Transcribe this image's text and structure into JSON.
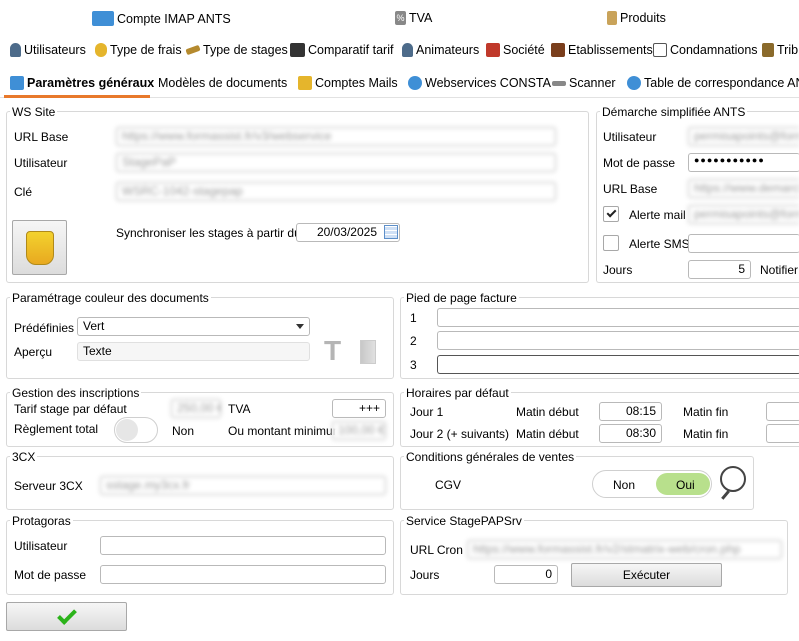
{
  "tabs_row1": [
    {
      "label": "Compte IMAP ANTS",
      "icon": "envelope-icon"
    },
    {
      "label": "TVA",
      "icon": "percent-icon"
    },
    {
      "label": "Produits",
      "icon": "bag-icon"
    }
  ],
  "tabs_row2": [
    {
      "label": "Utilisateurs",
      "icon": "user-icon"
    },
    {
      "label": "Type de frais",
      "icon": "euro-icon"
    },
    {
      "label": "Type de stages",
      "icon": "pencil-icon"
    },
    {
      "label": "Comparatif tarif",
      "icon": "people-icon"
    },
    {
      "label": "Animateurs",
      "icon": "person-icon"
    },
    {
      "label": "Société",
      "icon": "house-icon"
    },
    {
      "label": "Etablissements",
      "icon": "building-icon"
    },
    {
      "label": "Condamnations",
      "icon": "scales-icon"
    },
    {
      "label": "Trib",
      "icon": "court-icon"
    }
  ],
  "tabs_row3": [
    {
      "label": "Paramètres généraux",
      "icon": "settings-icon",
      "active": true
    },
    {
      "label": "Modèles de documents",
      "icon": ""
    },
    {
      "label": "Comptes Mails",
      "icon": "at-icon"
    },
    {
      "label": "Webservices CONSTA",
      "icon": "share-icon"
    },
    {
      "label": "Scanner",
      "icon": "scanner-icon"
    },
    {
      "label": "Table de correspondance ANTS",
      "icon": "share-icon"
    }
  ],
  "ws_site": {
    "title": "WS Site",
    "url_label": "URL Base",
    "url_value": "https://www.formassist.fr/v3/webservice",
    "user_label": "Utilisateur",
    "user_value": "StagePaP",
    "key_label": "Clé",
    "key_value": "WSRC-1042-stagepap",
    "sync_label": "Synchroniser les stages à partir du",
    "sync_date": "20/03/2025"
  },
  "ants": {
    "title": "Démarche simplifiée ANTS",
    "user_label": "Utilisateur",
    "user_value": "permisapoints@formassist",
    "password_label": "Mot de passe",
    "password_value": "●●●●●●●●●●●",
    "url_label": "URL Base",
    "url_value": "https://www.demarches",
    "alert_mail_label": "Alerte mail",
    "alert_mail_value": "permisapoints@formassist",
    "alert_sms_label": "Alerte SMS",
    "days_label": "Jours",
    "days_value": "5",
    "notify_label": "Notifier"
  },
  "doc_color": {
    "title": "Paramétrage couleur des documents",
    "predef_label": "Prédéfinies",
    "predef_value": "Vert",
    "preview_label": "Aperçu",
    "preview_value": "Texte"
  },
  "footer_invoice": {
    "title": "Pied de page facture",
    "lines": [
      "1",
      "2",
      "3"
    ]
  },
  "inscriptions": {
    "title": "Gestion des inscriptions",
    "tarif_label": "Tarif stage par défaut",
    "tarif_value": "250,00 €",
    "tva_label": "TVA",
    "tva_value": "+++",
    "reglement_label": "Règlement total",
    "reglement_state": "Non",
    "min_label": "Ou montant minimum",
    "min_value": "100,00 €"
  },
  "horaires": {
    "title": "Horaires par défaut",
    "rows": [
      {
        "label": "Jour 1",
        "start_label": "Matin début",
        "start": "08:15",
        "end_label": "Matin fin"
      },
      {
        "label": "Jour 2 (+ suivants)",
        "start_label": "Matin début",
        "start": "08:30",
        "end_label": "Matin fin"
      }
    ]
  },
  "cx": {
    "title": "3CX",
    "server_label": "Serveur 3CX",
    "server_value": "sstage.my3cx.fr"
  },
  "cgv": {
    "title": "Conditions générales de ventes",
    "label": "CGV",
    "off": "Non",
    "on": "Oui"
  },
  "protagoras": {
    "title": "Protagoras",
    "user_label": "Utilisateur",
    "pass_label": "Mot de passe"
  },
  "service": {
    "title": "Service StagePAPSrv",
    "url_label": "URL Cron",
    "url_value": "https://www.formassist.fr/v2/stmatrix-web/cron.php",
    "days_label": "Jours",
    "days_value": "0",
    "run_label": "Exécuter"
  },
  "colors": {
    "accent": "#e8792b",
    "check": "#2bb31a",
    "toggle_on": "#b8e08c"
  }
}
